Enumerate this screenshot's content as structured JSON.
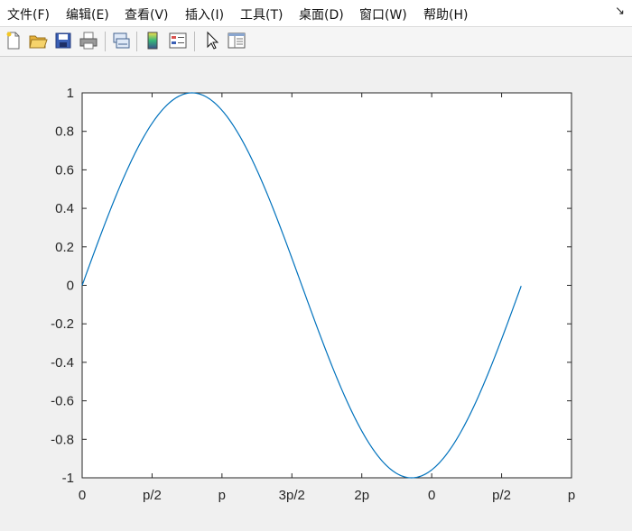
{
  "menu": {
    "items": [
      "文件(F)",
      "编辑(E)",
      "查看(V)",
      "插入(I)",
      "工具(T)",
      "桌面(D)",
      "窗口(W)",
      "帮助(H)"
    ],
    "overflow_icon": "corner-arrow-icon"
  },
  "toolbar": {
    "buttons": [
      {
        "icon": "new-file-icon"
      },
      {
        "icon": "open-folder-icon"
      },
      {
        "icon": "save-icon"
      },
      {
        "icon": "print-icon"
      },
      {
        "icon": "link-plot-icon"
      },
      {
        "icon": "insert-colorbar-icon"
      },
      {
        "icon": "insert-legend-icon"
      },
      {
        "icon": "pointer-icon"
      },
      {
        "icon": "property-inspector-icon"
      }
    ]
  },
  "colors": {
    "line": "#0072bd",
    "axes": "#262626",
    "background": "#f0f0f0",
    "plot_bg": "#ffffff"
  },
  "chart_data": {
    "type": "line",
    "xlim": [
      0,
      7
    ],
    "ylim": [
      -1,
      1
    ],
    "x_ticks": [
      0,
      1,
      2,
      3,
      4,
      5,
      6,
      7
    ],
    "x_tick_labels": [
      "0",
      "p/2",
      "p",
      "3p/2",
      "2p",
      "0",
      "p/2",
      "p"
    ],
    "y_ticks": [
      -1,
      -0.8,
      -0.6,
      -0.4,
      -0.2,
      0,
      0.2,
      0.4,
      0.6,
      0.8,
      1
    ],
    "y_tick_labels": [
      "-1",
      "-0.8",
      "-0.6",
      "-0.4",
      "-0.2",
      "0",
      "0.2",
      "0.4",
      "0.6",
      "0.8",
      "1"
    ],
    "series": [
      {
        "function": "sin",
        "x": [
          0,
          0.25,
          0.5,
          0.75,
          1.0,
          1.25,
          1.5,
          1.75,
          2.0,
          2.25,
          2.5,
          2.75,
          3.0,
          3.25,
          3.5,
          3.75,
          4.0,
          4.25,
          4.5,
          4.75,
          5.0,
          5.25,
          5.5,
          5.75,
          6.0,
          6.25,
          6.28
        ],
        "y": [
          0,
          0.247,
          0.479,
          0.682,
          0.841,
          0.949,
          0.997,
          0.984,
          0.909,
          0.778,
          0.598,
          0.382,
          0.141,
          -0.108,
          -0.351,
          -0.572,
          -0.757,
          -0.895,
          -0.978,
          -0.999,
          -0.959,
          -0.859,
          -0.706,
          -0.508,
          -0.279,
          -0.033,
          0
        ]
      }
    ],
    "grid": false
  }
}
